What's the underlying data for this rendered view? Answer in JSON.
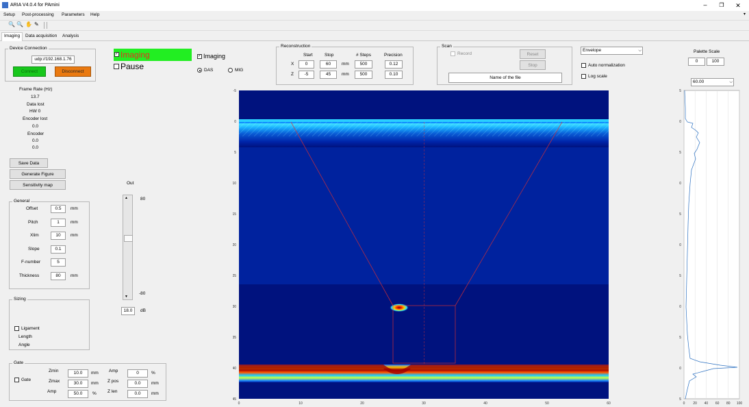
{
  "window": {
    "title": "ARIA V4.0.4 for PAmini"
  },
  "menu": [
    "Setup",
    "Post-processing",
    "Parameters",
    "Help"
  ],
  "tabs": [
    "Imaging",
    "Data acquisition",
    "Analysis"
  ],
  "device": {
    "title": "Device Connection",
    "ip": "udp://192.168.1.76",
    "connect": "Connect",
    "disconnect": "Disconnect"
  },
  "status": {
    "frame_rate_label": "Frame Rate (Hz)",
    "frame_rate": "13.7",
    "data_lost_label": "Data lost",
    "hw": "HW 0",
    "encoder_lost_label": "Encoder lost",
    "encoder_lost": "0.0",
    "encoder_label": "Encoder",
    "encoder_1": "0.0",
    "encoder_2": "0.0"
  },
  "buttons": {
    "save": "Save Data",
    "figure": "Generate Figure",
    "sensitivity": "Sensitivity map"
  },
  "general": {
    "title": "General",
    "rows": [
      {
        "label": "Offset",
        "value": "0.5",
        "unit": "mm"
      },
      {
        "label": "Pitch",
        "value": "1",
        "unit": "mm"
      },
      {
        "label": "Xlim",
        "value": "10",
        "unit": "mm"
      },
      {
        "label": "Slope",
        "value": "0.1",
        "unit": ""
      },
      {
        "label": "F-number",
        "value": "5",
        "unit": ""
      },
      {
        "label": "Thickness",
        "value": "80",
        "unit": "mm"
      }
    ]
  },
  "sizing": {
    "title": "Sizing",
    "ligament": "Ligament",
    "length": "Length",
    "angle": "Angle"
  },
  "gate": {
    "title": "Gate",
    "gate_label": "Gate",
    "zmin_label": "Zmin",
    "zmin": "10.0",
    "zmax_label": "Zmax",
    "zmax": "30.0",
    "amp_label": "Amp",
    "amp": "50.0",
    "amp_unit": "%",
    "amp2_label": "Amp",
    "amp2": "0",
    "zpos_label": "Z pos",
    "zpos": "0.0",
    "zlen_label": "Z len",
    "zlen": "0.0",
    "mm": "mm"
  },
  "imaging_toggle": {
    "imaging": "Imaging",
    "pause": "Pause"
  },
  "imaging_mode": {
    "imaging": "Imaging",
    "das": "DAS",
    "mig": "MIG"
  },
  "slider": {
    "out": "Out",
    "top": "80",
    "bottom": "-80",
    "db_value": "18.0",
    "db_unit": "dB"
  },
  "reconstruction": {
    "title": "Reconstruction",
    "col_start": "Start",
    "col_stop": "Stop",
    "col_steps": "# Steps",
    "col_precision": "Precision",
    "x_label": "X",
    "x_start": "0",
    "x_stop": "60",
    "x_unit": "mm",
    "x_steps": "500",
    "x_precision": "0.12",
    "z_label": "Z",
    "z_start": "-5",
    "z_stop": "45",
    "z_unit": "mm",
    "z_steps": "500",
    "z_precision": "0.10"
  },
  "scan": {
    "title": "Scan",
    "record": "Record",
    "reset": "Reset",
    "stop": "Stop",
    "filename": "Name of the file"
  },
  "display": {
    "envelope": "Envelope",
    "auto_norm": "Auto normalization",
    "log_scale": "Log scale"
  },
  "palette": {
    "title": "Palette Scale",
    "min": "0",
    "max": "100",
    "value": "60.00"
  },
  "image_axes": {
    "x_ticks": [
      "0",
      "10",
      "20",
      "30",
      "40",
      "50",
      "60"
    ],
    "y_ticks": [
      "-5",
      "0",
      "5",
      "10",
      "15",
      "20",
      "25",
      "30",
      "35",
      "40",
      "45"
    ]
  },
  "profile_axes": {
    "x_ticks": [
      "0",
      "20",
      "40",
      "60",
      "80",
      "100"
    ],
    "y_ticks": [
      "-5",
      "0",
      "5",
      "10",
      "15",
      "20",
      "25",
      "30",
      "35",
      "40",
      "45"
    ]
  },
  "colors": {
    "jet_dark": "#00007f",
    "connect_green": "#18c71c",
    "disconnect_orange": "#ea7a11",
    "imaging_green": "#22ee22",
    "trace_blue": "#2a6fc0"
  }
}
